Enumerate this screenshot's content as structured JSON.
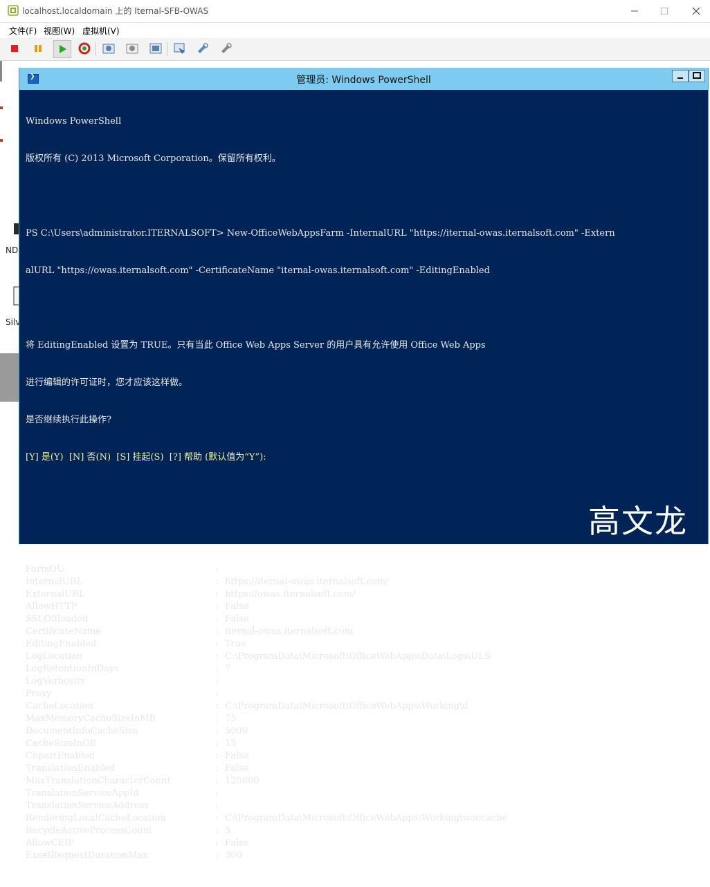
{
  "window": {
    "title": "localhost.localdomain 上的 Iternal-SFB-OWAS"
  },
  "menu": {
    "items": [
      "文件(F)",
      "视图(W)",
      "虚拟机(V)"
    ]
  },
  "toolbar": {
    "buttons": [
      {
        "name": "stop-icon",
        "color": "#e02020"
      },
      {
        "name": "pause-icon",
        "color": "#e8a000"
      },
      {
        "name": "play-icon",
        "color": "#22aa22"
      },
      {
        "name": "reset-icon",
        "color": "#d02020"
      },
      {
        "name": "snapshot-icon",
        "color": "#5a7fa8"
      },
      {
        "name": "revert-icon",
        "color": "#8a8a8a"
      },
      {
        "name": "snapshot-manager-icon",
        "color": "#5a7fa8"
      },
      {
        "name": "settings-icon",
        "color": "#3e6fa3"
      },
      {
        "name": "tools-icon",
        "color": "#5a8ab8"
      },
      {
        "name": "install-tools-icon",
        "color": "#888888"
      }
    ]
  },
  "desktop": {
    "labels": [
      "ND",
      "Silv"
    ]
  },
  "powershell": {
    "title": "管理员: Windows PowerShell",
    "header_line1": "Windows PowerShell",
    "header_line2": "版权所有 (C) 2013 Microsoft Corporation。保留所有权利。",
    "command_line1": "PS C:\\Users\\administrator.ITERNALSOFT> New-OfficeWebAppsFarm -InternalURL \"https://iternal-owas.iternalsoft.com\" -Extern",
    "command_line2": "alURL \"https://owas.iternalsoft.com\" -CertificateName \"iternal-owas.iternalsoft.com\" -EditingEnabled",
    "warning_line1": "将 EditingEnabled 设置为 TRUE。只有当此 Office Web Apps Server 的用户具有允许使用 Office Web Apps",
    "warning_line2": "进行编辑的许可证时，您才应该这样做。",
    "warning_line3": "是否继续执行此操作?",
    "prompt_line": "[Y] 是(Y)  [N] 否(N)  [S] 挂起(S)  [?] 帮助 (默认值为“Y”):",
    "properties": [
      {
        "key": "FarmOU",
        "value": ""
      },
      {
        "key": "InternalURL",
        "value": "https://iternal-owas.iternalsoft.com/"
      },
      {
        "key": "ExternalURL",
        "value": "https://owas.iternalsoft.com/"
      },
      {
        "key": "AllowHTTP",
        "value": "False"
      },
      {
        "key": "SSLOffloaded",
        "value": "False"
      },
      {
        "key": "CertificateName",
        "value": "iternal-owas.iternalsoft.com"
      },
      {
        "key": "EditingEnabled",
        "value": "True"
      },
      {
        "key": "LogLocation",
        "value": "C:\\ProgramData\\Microsoft\\OfficeWebApps\\Data\\Logs\\ULS"
      },
      {
        "key": "LogRetentionInDays",
        "value": "7"
      },
      {
        "key": "LogVerbosity",
        "value": ""
      },
      {
        "key": "Proxy",
        "value": ""
      },
      {
        "key": "CacheLocation",
        "value": "C:\\ProgramData\\Microsoft\\OfficeWebApps\\Working\\d"
      },
      {
        "key": "MaxMemoryCacheSizeInMB",
        "value": "75"
      },
      {
        "key": "DocumentInfoCacheSize",
        "value": "5000"
      },
      {
        "key": "CacheSizeInGB",
        "value": "15"
      },
      {
        "key": "ClipartEnabled",
        "value": "False"
      },
      {
        "key": "TranslationEnabled",
        "value": "False"
      },
      {
        "key": "MaxTranslationCharacterCount",
        "value": "125000"
      },
      {
        "key": "TranslationServiceAppId",
        "value": ""
      },
      {
        "key": "TranslationServiceAddress",
        "value": ""
      },
      {
        "key": "RenderingLocalCacheLocation",
        "value": "C:\\ProgramData\\Microsoft\\OfficeWebApps\\Working\\waccache"
      },
      {
        "key": "RecycleActiveProcessCount",
        "value": "5"
      },
      {
        "key": "AllowCEIP",
        "value": "False"
      },
      {
        "key": "ExcelRequestDurationMax",
        "value": "300"
      }
    ]
  },
  "watermark": "高文龙"
}
